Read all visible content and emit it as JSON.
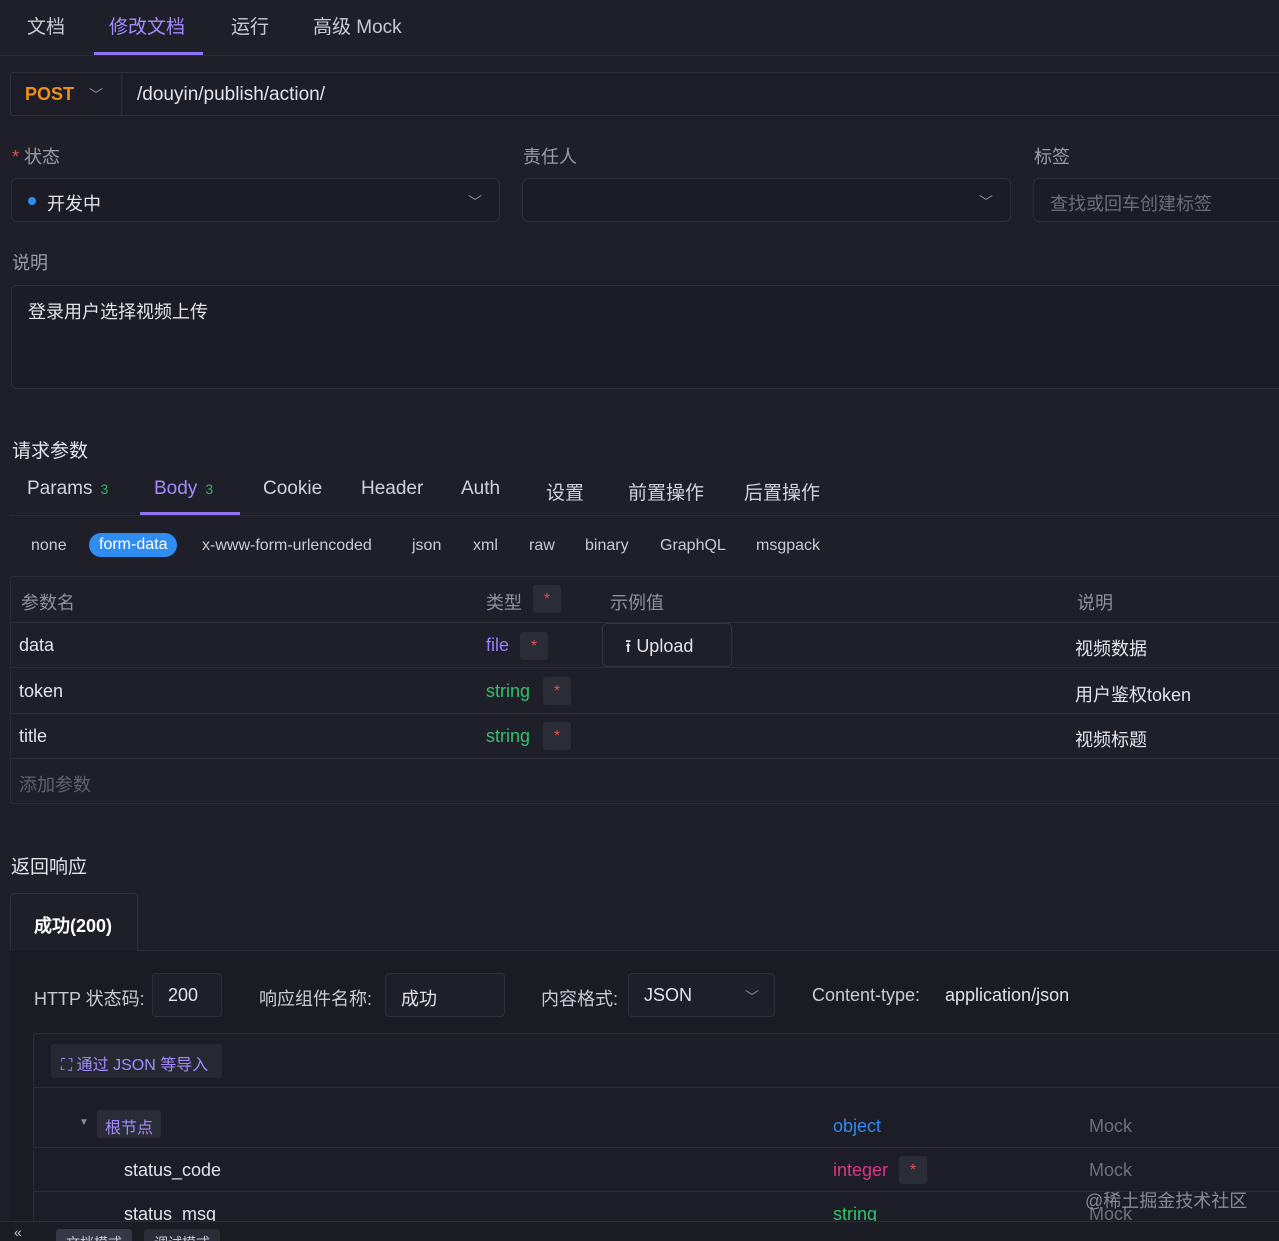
{
  "top_tabs": [
    "文档",
    "修改文档",
    "运行",
    "高级 Mock"
  ],
  "request": {
    "method": "POST",
    "path": "/douyin/publish/action/"
  },
  "meta": {
    "status_label": "状态",
    "status_value": "开发中",
    "owner_label": "责任人",
    "tags_label": "标签",
    "tags_placeholder": "查找或回车创建标签",
    "desc_label": "说明",
    "desc_value": "登录用户选择视频上传"
  },
  "params": {
    "section_title": "请求参数",
    "tabs": [
      {
        "label": "Params",
        "count": "3"
      },
      {
        "label": "Body",
        "count": "3"
      },
      {
        "label": "Cookie"
      },
      {
        "label": "Header"
      },
      {
        "label": "Auth"
      },
      {
        "label": "设置"
      },
      {
        "label": "前置操作"
      },
      {
        "label": "后置操作"
      }
    ],
    "body_types": [
      "none",
      "form-data",
      "x-www-form-urlencoded",
      "json",
      "xml",
      "raw",
      "binary",
      "GraphQL",
      "msgpack"
    ],
    "columns": [
      "参数名",
      "类型",
      "示例值",
      "说明"
    ],
    "rows": [
      {
        "name": "data",
        "type": "file",
        "example": "Upload",
        "desc": "视频数据"
      },
      {
        "name": "token",
        "type": "string",
        "example": "",
        "desc": "用户鉴权token"
      },
      {
        "name": "title",
        "type": "string",
        "example": "",
        "desc": "视频标题"
      }
    ],
    "add_placeholder": "添加参数"
  },
  "response": {
    "section_title": "返回响应",
    "tab": "成功(200)",
    "status_code_label": "HTTP 状态码:",
    "status_code": "200",
    "component_label": "响应组件名称:",
    "component_name": "成功",
    "format_label": "内容格式:",
    "format": "JSON",
    "content_type_label": "Content-type:",
    "content_type": "application/json",
    "import_label": "通过 JSON 等导入",
    "root_label": "根节点",
    "root_type": "object",
    "fields": [
      {
        "name": "status_code",
        "type": "integer",
        "mock": "Mock"
      },
      {
        "name": "status_msg",
        "type": "string",
        "mock": "Mock"
      }
    ],
    "root_mock": "Mock"
  },
  "watermark": "@稀土掘金技术社区",
  "bottom_tabs": [
    "文档模式",
    "调试模式"
  ],
  "colors": {
    "accent": "#8e74f2",
    "method": "#f0901b",
    "primary": "#2f8cf0",
    "string": "#35c26b",
    "required": "#e54b4b"
  }
}
